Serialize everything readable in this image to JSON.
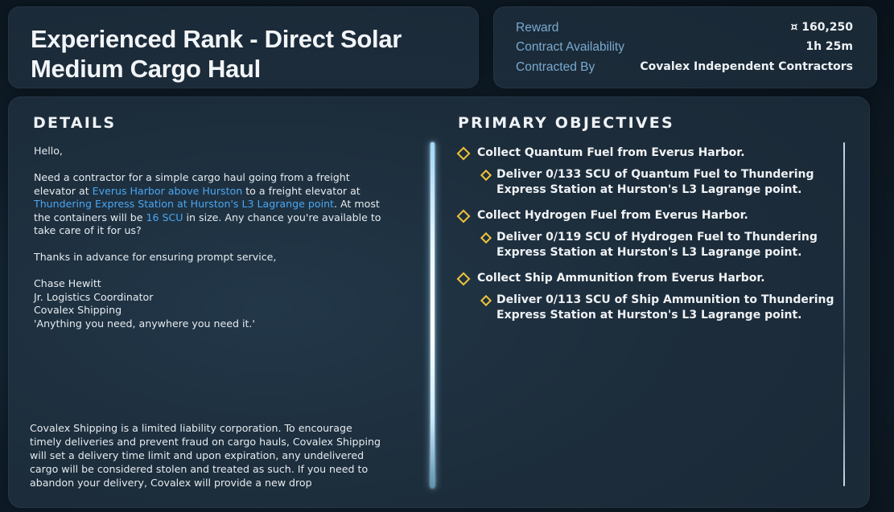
{
  "contract": {
    "title": "Experienced Rank - Direct Solar Medium Cargo Haul"
  },
  "info": {
    "reward_label": "Reward",
    "reward_value": "¤ 160,250",
    "availability_label": "Contract Availability",
    "availability_value": "1h 25m",
    "contracted_by_label": "Contracted By",
    "contracted_by_value": "Covalex Independent Contractors"
  },
  "details": {
    "heading": "DETAILS",
    "greeting": "Hello,",
    "body_1": "Need a contractor for a simple cargo haul going from a freight elevator at ",
    "link_origin": "Everus Harbor above Hurston",
    "body_2": " to a freight elevator at ",
    "link_destination": "Thundering Express Station at Hurston's L3 Lagrange point",
    "body_3": ". At most the containers will be ",
    "link_size": "16 SCU",
    "body_4": " in size. Any chance you're available to take care of it for us?",
    "thanks": "Thanks in advance for ensuring prompt service,",
    "signature_name": "Chase Hewitt",
    "signature_title": "Jr. Logistics Coordinator",
    "signature_company": "Covalex Shipping",
    "signature_motto": "'Anything you need, anywhere you need it.'",
    "disclaimer": "Covalex Shipping is a limited liability corporation. To encourage timely deliveries and prevent fraud on cargo hauls, Covalex Shipping will set a delivery time limit and upon expiration, any undelivered cargo will be considered stolen and treated as such. If you need to abandon your delivery, Covalex will provide a new drop"
  },
  "objectives": {
    "heading": "PRIMARY OBJECTIVES",
    "items": [
      {
        "label": "Collect Quantum Fuel from Everus Harbor.",
        "sub": "Deliver 0/133 SCU of Quantum Fuel to Thundering Express Station at Hurston's L3 Lagrange point."
      },
      {
        "label": "Collect Hydrogen Fuel from Everus Harbor.",
        "sub": "Deliver 0/119 SCU of Hydrogen Fuel to Thundering Express Station at Hurston's L3 Lagrange point."
      },
      {
        "label": "Collect Ship Ammunition from Everus Harbor.",
        "sub": "Deliver 0/113 SCU of Ship Ammunition to Thundering Express Station at Hurston's L3 Lagrange point."
      }
    ]
  },
  "colors": {
    "link": "#4aa6f2",
    "label": "#7aaad0",
    "objective_marker": "#f0c23a"
  }
}
